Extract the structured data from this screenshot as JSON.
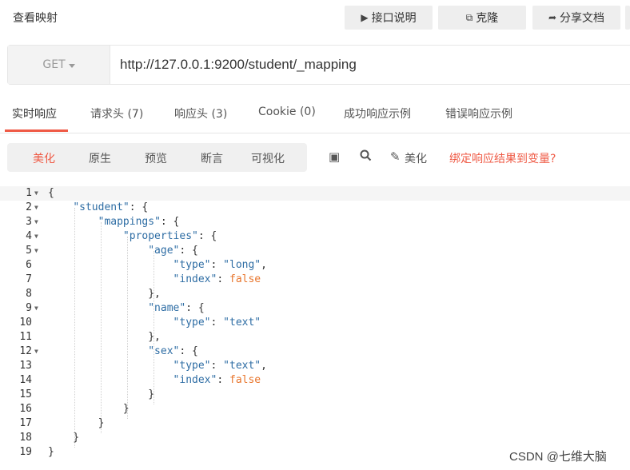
{
  "header": {
    "title": "查看映射",
    "buttons": {
      "doc": "接口说明",
      "clone": "克隆",
      "share": "分享文档"
    }
  },
  "request": {
    "method": "GET",
    "url": "http://127.0.0.1:9200/student/_mapping"
  },
  "tabs": [
    {
      "label": "实时响应"
    },
    {
      "label": "请求头 (7)"
    },
    {
      "label": "响应头 (3)"
    },
    {
      "label": "Cookie (0)"
    },
    {
      "label": "成功响应示例"
    },
    {
      "label": "错误响应示例"
    }
  ],
  "format_tabs": [
    {
      "label": "美化"
    },
    {
      "label": "原生"
    },
    {
      "label": "预览"
    },
    {
      "label": "断言"
    },
    {
      "label": "可视化"
    }
  ],
  "toolbar": {
    "beautify_label": "美化",
    "bind_link": "绑定响应结果到变量?"
  },
  "code_lines": [
    {
      "n": "1",
      "text": "{"
    },
    {
      "n": "2",
      "text": "    \"student\": {"
    },
    {
      "n": "3",
      "text": "        \"mappings\": {"
    },
    {
      "n": "4",
      "text": "            \"properties\": {"
    },
    {
      "n": "5",
      "text": "                \"age\": {"
    },
    {
      "n": "6",
      "text": "                    \"type\": \"long\","
    },
    {
      "n": "7",
      "text": "                    \"index\": false"
    },
    {
      "n": "8",
      "text": "                },"
    },
    {
      "n": "9",
      "text": "                \"name\": {"
    },
    {
      "n": "10",
      "text": "                    \"type\": \"text\""
    },
    {
      "n": "11",
      "text": "                },"
    },
    {
      "n": "12",
      "text": "                \"sex\": {"
    },
    {
      "n": "13",
      "text": "                    \"type\": \"text\","
    },
    {
      "n": "14",
      "text": "                    \"index\": false"
    },
    {
      "n": "15",
      "text": "                }"
    },
    {
      "n": "16",
      "text": "            }"
    },
    {
      "n": "17",
      "text": "        }"
    },
    {
      "n": "18",
      "text": "    }"
    },
    {
      "n": "19",
      "text": "}"
    }
  ],
  "watermark": "CSDN @七维大脑",
  "colors": {
    "accent": "#ef5a45",
    "json_key": "#2e6da4",
    "json_bool": "#e8752c"
  }
}
